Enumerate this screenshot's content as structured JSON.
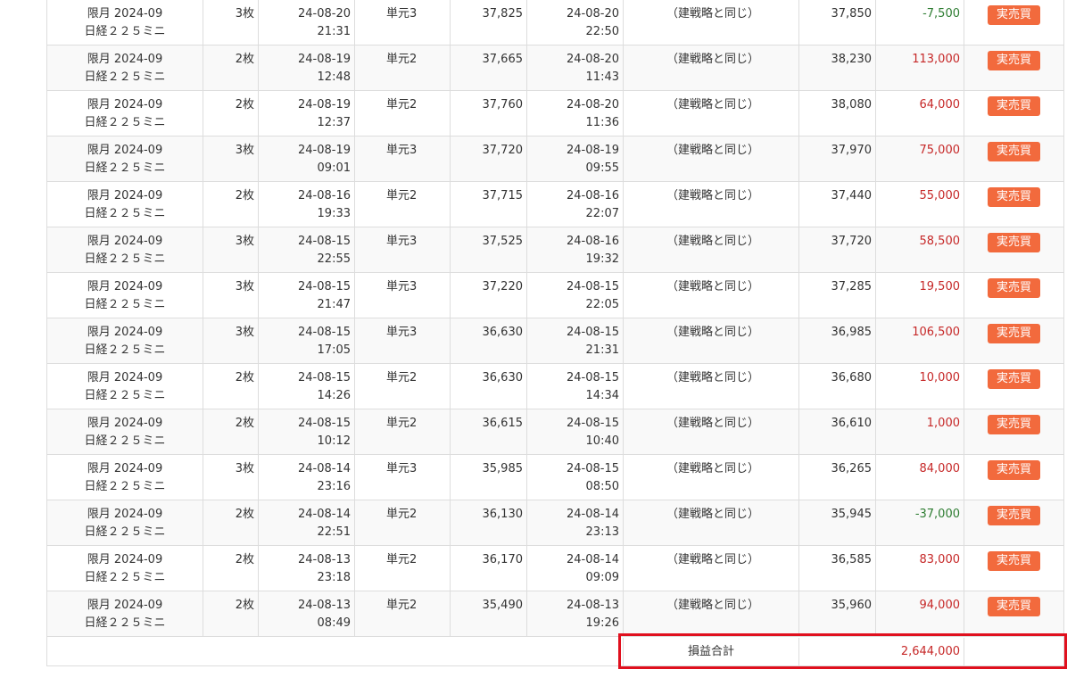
{
  "rows": [
    {
      "contract": "限月 2024-09",
      "product": "日経２２５ミニ",
      "qty": "3枚",
      "entry_date": "24-08-20",
      "entry_time": "21:31",
      "unit": "単元3",
      "entry_price": "37,825",
      "exit_date": "24-08-20",
      "exit_time": "22:50",
      "strategy": "（建戦略と同じ）",
      "exit_price": "37,850",
      "pnl": "-7,500",
      "pnl_sign": "neg",
      "action": "実売買"
    },
    {
      "contract": "限月 2024-09",
      "product": "日経２２５ミニ",
      "qty": "2枚",
      "entry_date": "24-08-19",
      "entry_time": "12:48",
      "unit": "単元2",
      "entry_price": "37,665",
      "exit_date": "24-08-20",
      "exit_time": "11:43",
      "strategy": "（建戦略と同じ）",
      "exit_price": "38,230",
      "pnl": "113,000",
      "pnl_sign": "pos",
      "action": "実売買"
    },
    {
      "contract": "限月 2024-09",
      "product": "日経２２５ミニ",
      "qty": "2枚",
      "entry_date": "24-08-19",
      "entry_time": "12:37",
      "unit": "単元2",
      "entry_price": "37,760",
      "exit_date": "24-08-20",
      "exit_time": "11:36",
      "strategy": "（建戦略と同じ）",
      "exit_price": "38,080",
      "pnl": "64,000",
      "pnl_sign": "pos",
      "action": "実売買"
    },
    {
      "contract": "限月 2024-09",
      "product": "日経２２５ミニ",
      "qty": "3枚",
      "entry_date": "24-08-19",
      "entry_time": "09:01",
      "unit": "単元3",
      "entry_price": "37,720",
      "exit_date": "24-08-19",
      "exit_time": "09:55",
      "strategy": "（建戦略と同じ）",
      "exit_price": "37,970",
      "pnl": "75,000",
      "pnl_sign": "pos",
      "action": "実売買"
    },
    {
      "contract": "限月 2024-09",
      "product": "日経２２５ミニ",
      "qty": "2枚",
      "entry_date": "24-08-16",
      "entry_time": "19:33",
      "unit": "単元2",
      "entry_price": "37,715",
      "exit_date": "24-08-16",
      "exit_time": "22:07",
      "strategy": "（建戦略と同じ）",
      "exit_price": "37,440",
      "pnl": "55,000",
      "pnl_sign": "pos",
      "action": "実売買"
    },
    {
      "contract": "限月 2024-09",
      "product": "日経２２５ミニ",
      "qty": "3枚",
      "entry_date": "24-08-15",
      "entry_time": "22:55",
      "unit": "単元3",
      "entry_price": "37,525",
      "exit_date": "24-08-16",
      "exit_time": "19:32",
      "strategy": "（建戦略と同じ）",
      "exit_price": "37,720",
      "pnl": "58,500",
      "pnl_sign": "pos",
      "action": "実売買"
    },
    {
      "contract": "限月 2024-09",
      "product": "日経２２５ミニ",
      "qty": "3枚",
      "entry_date": "24-08-15",
      "entry_time": "21:47",
      "unit": "単元3",
      "entry_price": "37,220",
      "exit_date": "24-08-15",
      "exit_time": "22:05",
      "strategy": "（建戦略と同じ）",
      "exit_price": "37,285",
      "pnl": "19,500",
      "pnl_sign": "pos",
      "action": "実売買"
    },
    {
      "contract": "限月 2024-09",
      "product": "日経２２５ミニ",
      "qty": "3枚",
      "entry_date": "24-08-15",
      "entry_time": "17:05",
      "unit": "単元3",
      "entry_price": "36,630",
      "exit_date": "24-08-15",
      "exit_time": "21:31",
      "strategy": "（建戦略と同じ）",
      "exit_price": "36,985",
      "pnl": "106,500",
      "pnl_sign": "pos",
      "action": "実売買"
    },
    {
      "contract": "限月 2024-09",
      "product": "日経２２５ミニ",
      "qty": "2枚",
      "entry_date": "24-08-15",
      "entry_time": "14:26",
      "unit": "単元2",
      "entry_price": "36,630",
      "exit_date": "24-08-15",
      "exit_time": "14:34",
      "strategy": "（建戦略と同じ）",
      "exit_price": "36,680",
      "pnl": "10,000",
      "pnl_sign": "pos",
      "action": "実売買"
    },
    {
      "contract": "限月 2024-09",
      "product": "日経２２５ミニ",
      "qty": "2枚",
      "entry_date": "24-08-15",
      "entry_time": "10:12",
      "unit": "単元2",
      "entry_price": "36,615",
      "exit_date": "24-08-15",
      "exit_time": "10:40",
      "strategy": "（建戦略と同じ）",
      "exit_price": "36,610",
      "pnl": "1,000",
      "pnl_sign": "pos",
      "action": "実売買"
    },
    {
      "contract": "限月 2024-09",
      "product": "日経２２５ミニ",
      "qty": "3枚",
      "entry_date": "24-08-14",
      "entry_time": "23:16",
      "unit": "単元3",
      "entry_price": "35,985",
      "exit_date": "24-08-15",
      "exit_time": "08:50",
      "strategy": "（建戦略と同じ）",
      "exit_price": "36,265",
      "pnl": "84,000",
      "pnl_sign": "pos",
      "action": "実売買"
    },
    {
      "contract": "限月 2024-09",
      "product": "日経２２５ミニ",
      "qty": "2枚",
      "entry_date": "24-08-14",
      "entry_time": "22:51",
      "unit": "単元2",
      "entry_price": "36,130",
      "exit_date": "24-08-14",
      "exit_time": "23:13",
      "strategy": "（建戦略と同じ）",
      "exit_price": "35,945",
      "pnl": "-37,000",
      "pnl_sign": "neg",
      "action": "実売買"
    },
    {
      "contract": "限月 2024-09",
      "product": "日経２２５ミニ",
      "qty": "2枚",
      "entry_date": "24-08-13",
      "entry_time": "23:18",
      "unit": "単元2",
      "entry_price": "36,170",
      "exit_date": "24-08-14",
      "exit_time": "09:09",
      "strategy": "（建戦略と同じ）",
      "exit_price": "36,585",
      "pnl": "83,000",
      "pnl_sign": "pos",
      "action": "実売買"
    },
    {
      "contract": "限月 2024-09",
      "product": "日経２２５ミニ",
      "qty": "2枚",
      "entry_date": "24-08-13",
      "entry_time": "08:49",
      "unit": "単元2",
      "entry_price": "35,490",
      "exit_date": "24-08-13",
      "exit_time": "19:26",
      "strategy": "（建戦略と同じ）",
      "exit_price": "35,960",
      "pnl": "94,000",
      "pnl_sign": "pos",
      "action": "実売買"
    }
  ],
  "total": {
    "label": "損益合計",
    "value": "2,644,000"
  },
  "colors": {
    "negative": "#2e7d32",
    "positive": "#c62828",
    "button": "#f26a3d",
    "highlight": "#e0101e"
  }
}
